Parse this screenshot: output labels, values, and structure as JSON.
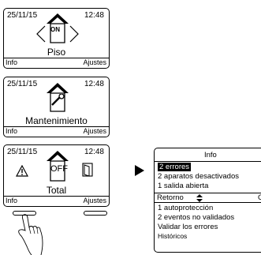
{
  "screen_piso": {
    "date": "25/11/15",
    "time": "12:48",
    "mode_icon_text": "ON",
    "label": "Piso",
    "soft_left": "Info",
    "soft_right": "Ajustes"
  },
  "screen_mantenimiento": {
    "date": "25/11/15",
    "time": "12:48",
    "label": "Mantenimiento",
    "soft_left": "Info",
    "soft_right": "Ajustes"
  },
  "screen_total": {
    "date": "25/11/15",
    "time": "12:48",
    "mode_icon_text": "OFF",
    "label": "Total",
    "soft_left": "Info",
    "soft_right": "Ajustes"
  },
  "info_panel": {
    "title": "Info",
    "items": [
      "2 errores",
      "2 aparatos desactivados",
      "1 salida abierta"
    ],
    "selected_index": 0,
    "soft_left": "Retorno",
    "soft_right": "C",
    "more_items": [
      "1 autoprotección",
      "2 eventos no validados",
      "Validar los errores",
      "Históricos"
    ]
  },
  "icons": [
    "home-icon",
    "left-arrow-icon",
    "right-arrow-icon",
    "wrench-icon",
    "warning-icon",
    "door-icon",
    "arrow-right-icon",
    "up-down-arrow-icon",
    "hand-pointer-icon"
  ]
}
